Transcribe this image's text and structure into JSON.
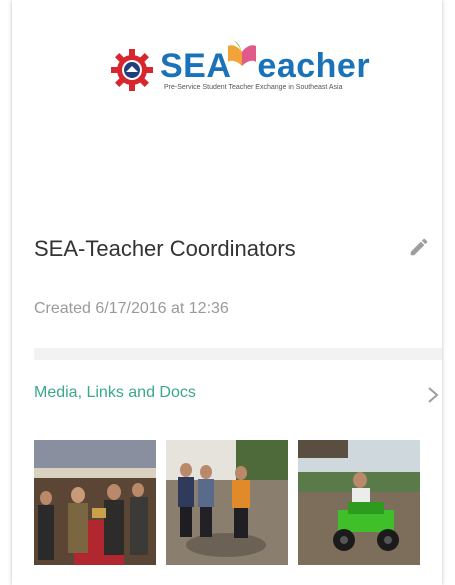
{
  "logo": {
    "wordmark_sea": "SEA",
    "wordmark_rest": "eacher",
    "tagline": "Pre-Service Student Teacher Exchange in Southeast Asia"
  },
  "group": {
    "title": "SEA-Teacher Coordinators",
    "created": "Created 6/17/2016 at 12:36"
  },
  "media": {
    "label": "Media, Links and Docs"
  },
  "thumbnails": [
    {
      "name": "photo-ceremony"
    },
    {
      "name": "photo-group-outdoors"
    },
    {
      "name": "photo-atv-ride"
    }
  ],
  "colors": {
    "accent_teal": "#3aa88a",
    "logo_blue": "#1a73b8",
    "gear_red": "#d8262e",
    "text_primary": "#333333",
    "text_secondary": "#9a9a9a"
  },
  "icons": {
    "edit": "edit-pencil-icon",
    "chevron": "chevron-right-icon"
  }
}
